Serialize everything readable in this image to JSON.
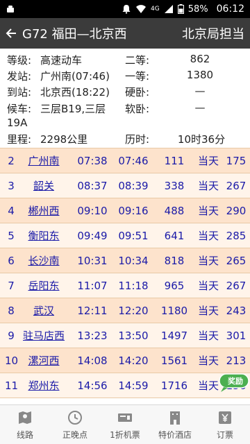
{
  "status": {
    "network": "4G",
    "battery": "58%",
    "time": "06:12"
  },
  "toolbar": {
    "title": "G72 福田—北京西",
    "bureau": "北京局担当"
  },
  "info": {
    "grade_label": "等级:",
    "grade_value": "高速动车",
    "second_label": "二等:",
    "second_value": "862",
    "from_label": "发站:",
    "from_value": "广州南(07:46)",
    "first_label": "一等:",
    "first_value": "1380",
    "to_label": "到站:",
    "to_value": "北京西(18:22)",
    "hard_sleeper_label": "硬卧:",
    "hard_sleeper_value": "—",
    "wait_label": "候车:",
    "wait_value_line1": "三层B19,三层",
    "wait_value_line2": "19A",
    "soft_sleeper_label": "软卧:",
    "soft_sleeper_value": "—",
    "distance_label": "里程:",
    "distance_value": "2298公里",
    "duration_label": "历时:",
    "duration_value": "10时36分"
  },
  "stops": [
    {
      "idx": "2",
      "station": "广州南",
      "arrive": "07:38",
      "depart": "07:46",
      "km": "111",
      "day": "当天",
      "minutes": "175"
    },
    {
      "idx": "3",
      "station": "韶关",
      "arrive": "08:37",
      "depart": "08:39",
      "km": "338",
      "day": "当天",
      "minutes": "267"
    },
    {
      "idx": "4",
      "station": "郴州西",
      "arrive": "09:10",
      "depart": "09:16",
      "km": "488",
      "day": "当天",
      "minutes": "290"
    },
    {
      "idx": "5",
      "station": "衡阳东",
      "arrive": "09:49",
      "depart": "09:51",
      "km": "641",
      "day": "当天",
      "minutes": "285"
    },
    {
      "idx": "6",
      "station": "长沙南",
      "arrive": "10:31",
      "depart": "10:34",
      "km": "818",
      "day": "当天",
      "minutes": "265"
    },
    {
      "idx": "7",
      "station": "岳阳东",
      "arrive": "11:07",
      "depart": "11:18",
      "km": "965",
      "day": "当天",
      "minutes": "267"
    },
    {
      "idx": "8",
      "station": "武汉",
      "arrive": "12:11",
      "depart": "12:20",
      "km": "1180",
      "day": "当天",
      "minutes": "243"
    },
    {
      "idx": "9",
      "station": "驻马店西",
      "arrive": "13:23",
      "depart": "13:50",
      "km": "1497",
      "day": "当天",
      "minutes": "301"
    },
    {
      "idx": "10",
      "station": "漯河西",
      "arrive": "14:08",
      "depart": "14:20",
      "km": "1561",
      "day": "当天",
      "minutes": "213"
    },
    {
      "idx": "11",
      "station": "郑州东",
      "arrive": "14:56",
      "depart": "14:59",
      "km": "1716",
      "day": "当天",
      "minutes": "156"
    }
  ],
  "award_badge": "奖励",
  "nav": [
    {
      "label": "线路",
      "icon": "map-icon"
    },
    {
      "label": "正晚点",
      "icon": "clock-icon"
    },
    {
      "label": "1折机票",
      "icon": "ticket-icon"
    },
    {
      "label": "特价酒店",
      "icon": "hotel-icon"
    },
    {
      "label": "订票",
      "icon": "yen-icon"
    }
  ],
  "colors": {
    "toolbar": "#3b3b3b",
    "row_odd": "#fde3cc",
    "row_even": "#fff4ea",
    "link": "#1a1aa8",
    "badge": "#4caf50"
  }
}
